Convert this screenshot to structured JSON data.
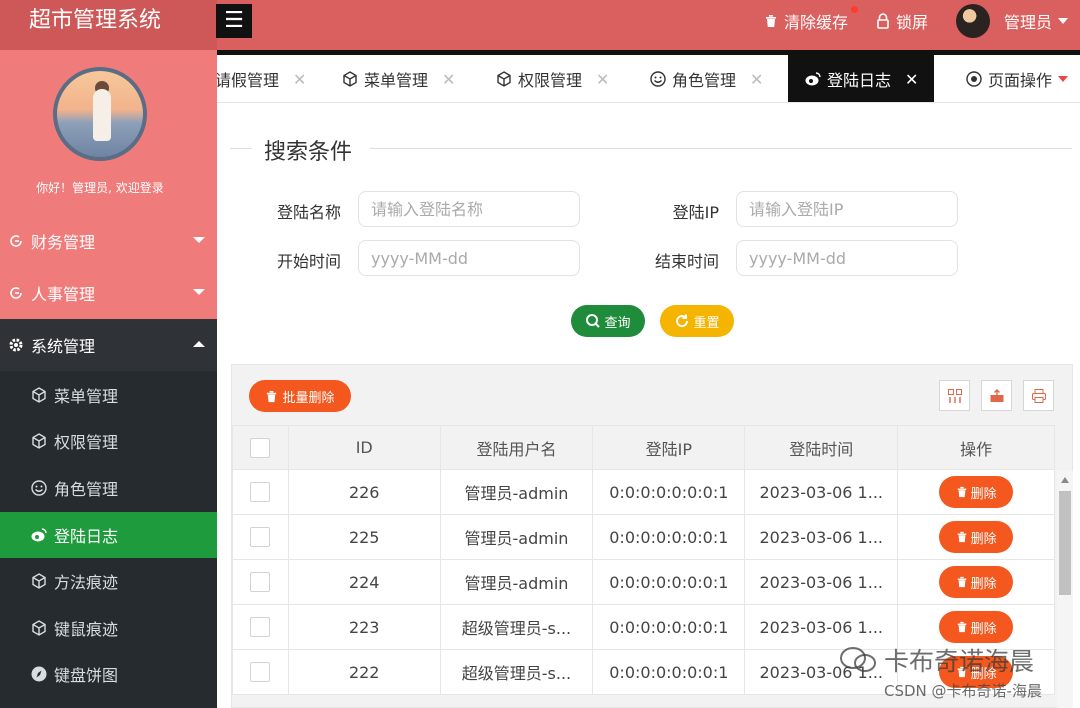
{
  "app": {
    "title": "超市管理系统"
  },
  "header": {
    "clear_cache": "清除缓存",
    "lock_screen": "锁屏",
    "user": "管理员"
  },
  "sidebar": {
    "welcome": "你好！管理员, 欢迎登录",
    "groups": [
      {
        "label": "财务管理"
      },
      {
        "label": "人事管理"
      },
      {
        "label": "系统管理"
      }
    ],
    "items": [
      {
        "label": "菜单管理"
      },
      {
        "label": "权限管理"
      },
      {
        "label": "角色管理"
      },
      {
        "label": "登陆日志"
      },
      {
        "label": "方法痕迹"
      },
      {
        "label": "键鼠痕迹"
      },
      {
        "label": "键盘饼图"
      }
    ]
  },
  "tabs": [
    {
      "label": "请假管理"
    },
    {
      "label": "菜单管理"
    },
    {
      "label": "权限管理"
    },
    {
      "label": "角色管理"
    },
    {
      "label": "登陆日志"
    }
  ],
  "page_ops": "页面操作",
  "search": {
    "title": "搜索条件",
    "login_name_label": "登陆名称",
    "login_name_placeholder": "请输入登陆名称",
    "login_ip_label": "登陆IP",
    "login_ip_placeholder": "请输入登陆IP",
    "start_label": "开始时间",
    "start_placeholder": "yyyy-MM-dd",
    "end_label": "结束时间",
    "end_placeholder": "yyyy-MM-dd",
    "query_button": "查询",
    "reset_button": "重置"
  },
  "table": {
    "batch_delete": "批量删除",
    "columns": [
      "ID",
      "登陆用户名",
      "登陆IP",
      "登陆时间",
      "操作"
    ],
    "delete_label": "删除",
    "rows": [
      {
        "id": "226",
        "user": "管理员-admin",
        "ip": "0:0:0:0:0:0:0:1",
        "time": "2023-03-06 1..."
      },
      {
        "id": "225",
        "user": "管理员-admin",
        "ip": "0:0:0:0:0:0:0:1",
        "time": "2023-03-06 1..."
      },
      {
        "id": "224",
        "user": "管理员-admin",
        "ip": "0:0:0:0:0:0:0:1",
        "time": "2023-03-06 1..."
      },
      {
        "id": "223",
        "user": "超级管理员-s...",
        "ip": "0:0:0:0:0:0:0:1",
        "time": "2023-03-06 1..."
      },
      {
        "id": "222",
        "user": "超级管理员-s...",
        "ip": "0:0:0:0:0:0:0:1",
        "time": "2023-03-06 1..."
      }
    ]
  },
  "watermark": {
    "line1": "卡布奇诺海晨",
    "line2": "CSDN @卡布奇诺-海晨"
  },
  "colors": {
    "header": "#d9605f",
    "sidebar_pink": "#f07b7b",
    "sidebar_dark": "#262b30",
    "active_green": "#1e9b3c",
    "danger_orange": "#f4581f",
    "warning_yellow": "#f5b400"
  }
}
